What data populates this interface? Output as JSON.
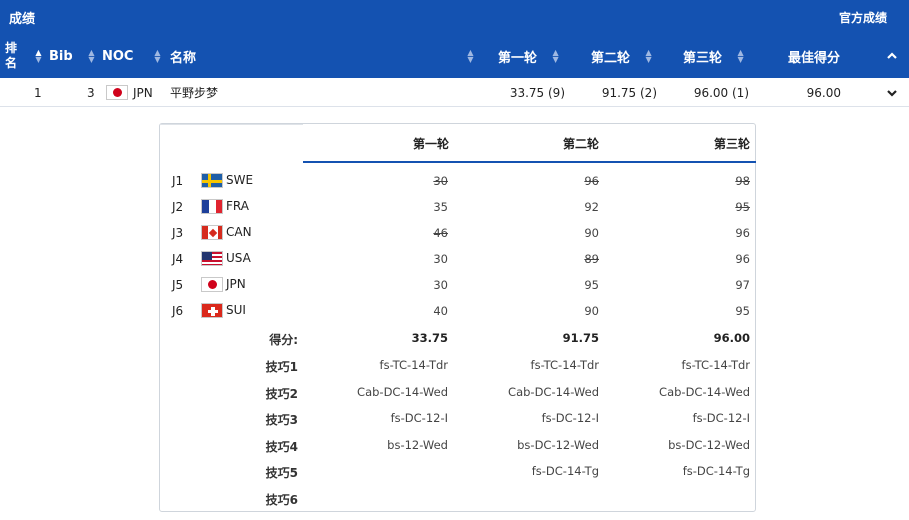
{
  "topbar": {
    "title": "成绩",
    "official": "官方成绩"
  },
  "columns": {
    "rank": "排名",
    "bib": "Bib",
    "noc": "NOC",
    "name": "名称",
    "r1": "第一轮",
    "r2": "第二轮",
    "r3": "第三轮",
    "best": "最佳得分"
  },
  "result": {
    "rank": "1",
    "bib": "3",
    "noc": "JPN",
    "name": "平野步梦",
    "r1": "33.75 (9)",
    "r2": "91.75 (2)",
    "r3": "96.00 (1)",
    "best": "96.00"
  },
  "detail": {
    "rounds": [
      "第一轮",
      "第二轮",
      "第三轮"
    ],
    "judges": [
      {
        "id": "J1",
        "noc": "SWE",
        "scores": [
          "30",
          "96",
          "98"
        ],
        "struck": [
          true,
          true,
          true
        ]
      },
      {
        "id": "J2",
        "noc": "FRA",
        "scores": [
          "35",
          "92",
          "95"
        ],
        "struck": [
          false,
          false,
          true
        ]
      },
      {
        "id": "J3",
        "noc": "CAN",
        "scores": [
          "46",
          "90",
          "96"
        ],
        "struck": [
          true,
          false,
          false
        ]
      },
      {
        "id": "J4",
        "noc": "USA",
        "scores": [
          "30",
          "89",
          "96"
        ],
        "struck": [
          false,
          true,
          false
        ]
      },
      {
        "id": "J5",
        "noc": "JPN",
        "scores": [
          "30",
          "95",
          "97"
        ],
        "struck": [
          false,
          false,
          false
        ]
      },
      {
        "id": "J6",
        "noc": "SUI",
        "scores": [
          "40",
          "90",
          "95"
        ],
        "struck": [
          false,
          false,
          false
        ]
      }
    ],
    "score_label": "得分:",
    "totals": [
      "33.75",
      "91.75",
      "96.00"
    ],
    "tricks": [
      {
        "label": "技巧1",
        "values": [
          "fs-TC-14-Tdr",
          "fs-TC-14-Tdr",
          "fs-TC-14-Tdr"
        ]
      },
      {
        "label": "技巧2",
        "values": [
          "Cab-DC-14-Wed",
          "Cab-DC-14-Wed",
          "Cab-DC-14-Wed"
        ]
      },
      {
        "label": "技巧3",
        "values": [
          "fs-DC-12-I",
          "fs-DC-12-I",
          "fs-DC-12-I"
        ]
      },
      {
        "label": "技巧4",
        "values": [
          "bs-12-Wed",
          "bs-DC-12-Wed",
          "bs-DC-12-Wed"
        ]
      },
      {
        "label": "技巧5",
        "values": [
          "",
          "fs-DC-14-Tg",
          "fs-DC-14-Tg"
        ]
      },
      {
        "label": "技巧6",
        "values": [
          "",
          "",
          ""
        ]
      }
    ]
  },
  "colors": {
    "brand": "#1452b1",
    "header_text": "#ffffff",
    "row_border": "#dde2ea"
  },
  "icons": {
    "sort": "sort-arrows-icon",
    "collapse": "chevron-up-icon",
    "expand": "chevron-down-icon"
  }
}
